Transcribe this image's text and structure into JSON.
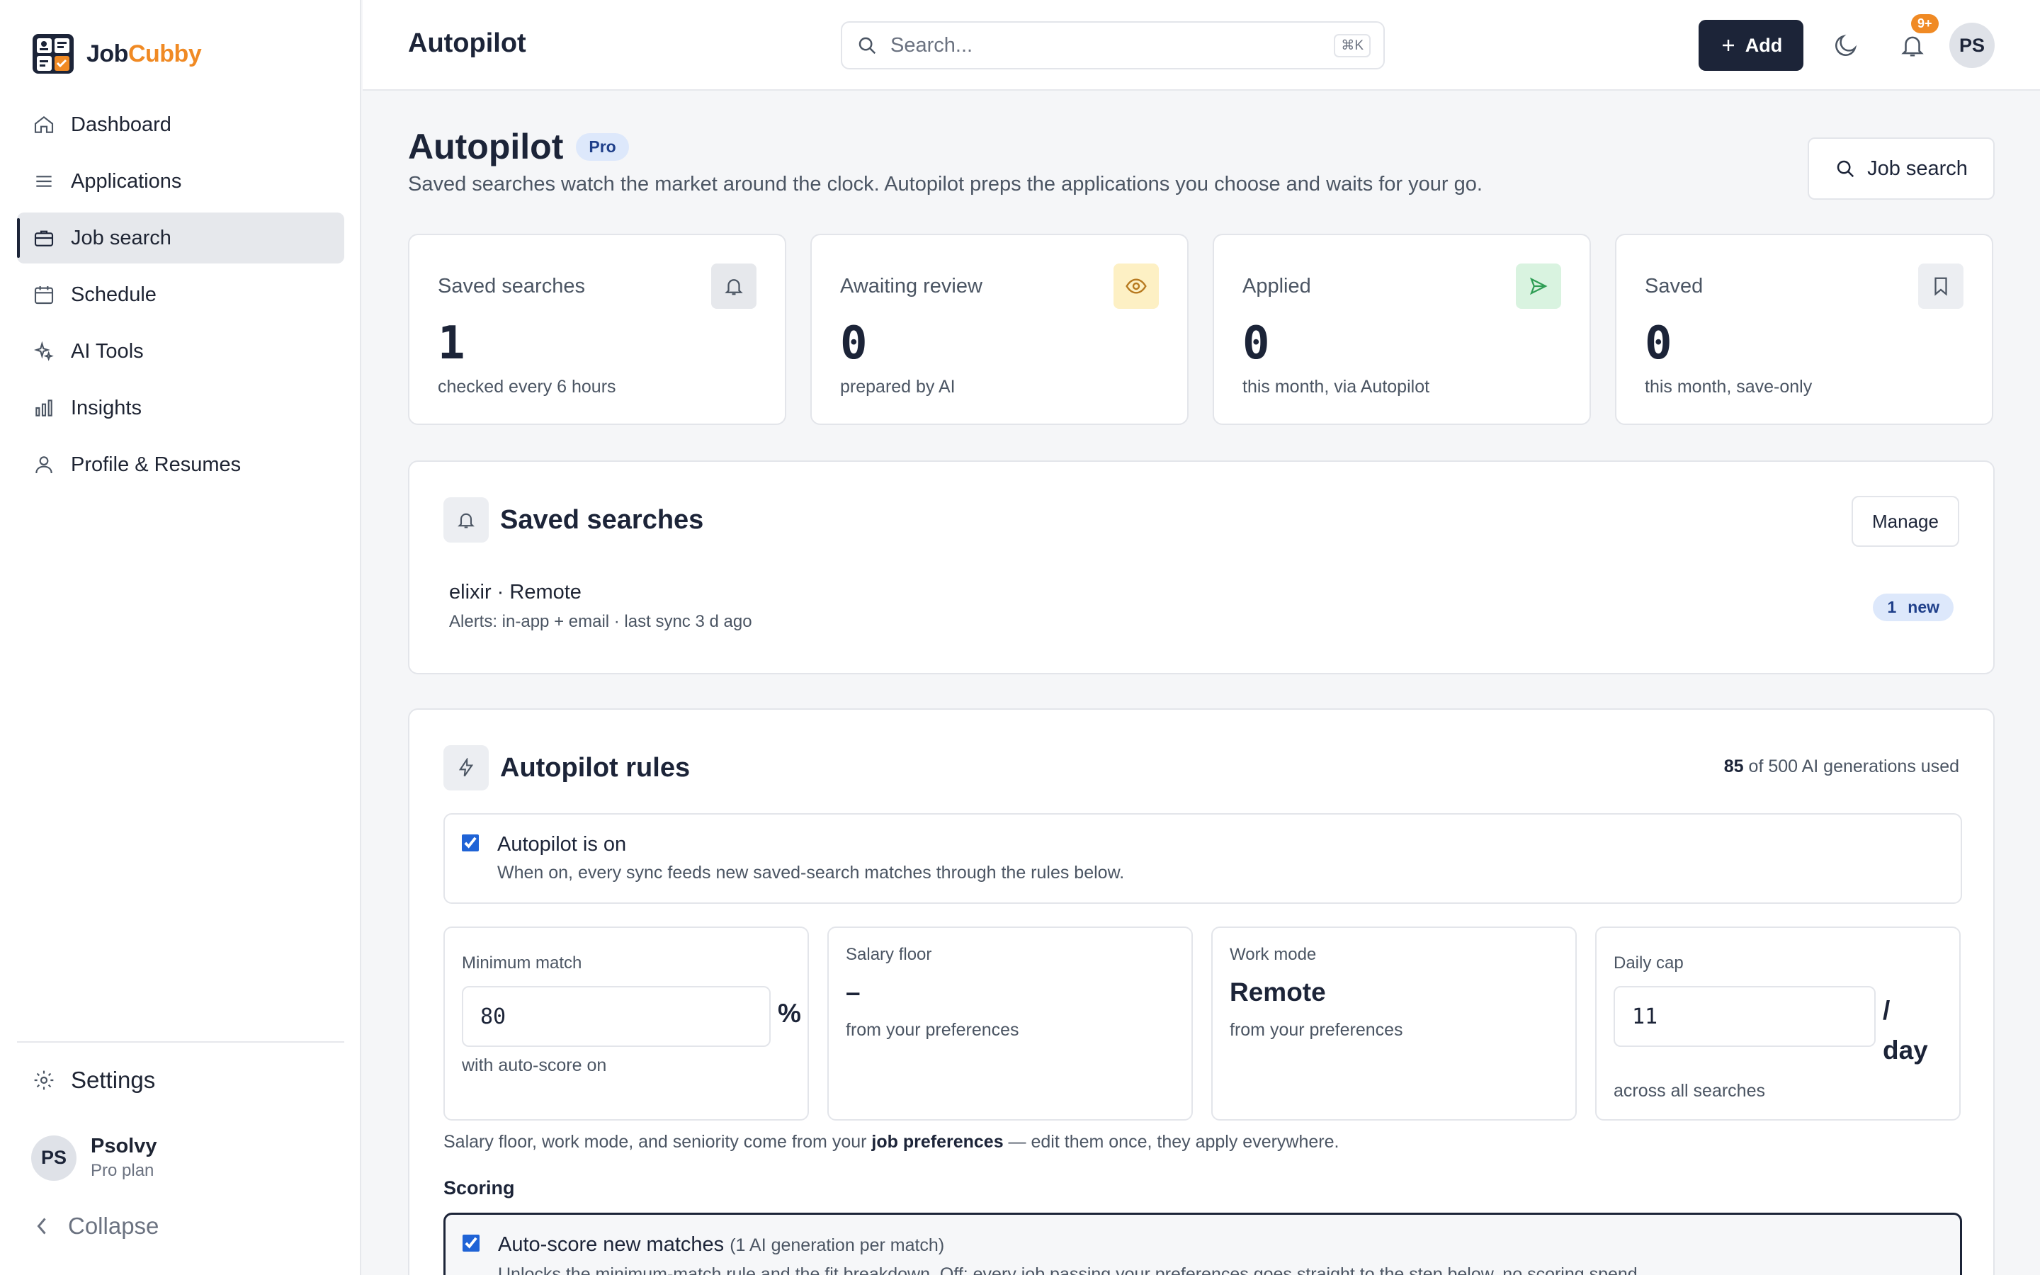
{
  "brand": {
    "name_part1": "Job",
    "name_part2": "Cubby",
    "accent_color": "#f08a24",
    "primary_color": "#1c2438"
  },
  "sidebar": {
    "items": [
      {
        "label": "Dashboard",
        "icon": "home-icon",
        "active": false
      },
      {
        "label": "Applications",
        "icon": "list-icon",
        "active": false
      },
      {
        "label": "Job search",
        "icon": "briefcase-icon",
        "active": true
      },
      {
        "label": "Schedule",
        "icon": "calendar-icon",
        "active": false
      },
      {
        "label": "AI Tools",
        "icon": "sparkles-icon",
        "active": false
      },
      {
        "label": "Insights",
        "icon": "bar-chart-icon",
        "active": false
      },
      {
        "label": "Profile & Resumes",
        "icon": "user-icon",
        "active": false
      }
    ],
    "settings_label": "Settings",
    "user": {
      "initials": "PS",
      "name": "Psolvy",
      "plan": "Pro plan"
    },
    "collapse_label": "Collapse"
  },
  "topbar": {
    "title": "Autopilot",
    "search_placeholder": "Search...",
    "search_shortcut": "⌘K",
    "add_label": "Add",
    "notification_badge": "9+",
    "avatar_initials": "PS"
  },
  "page": {
    "title": "Autopilot",
    "plan_pill": "Pro",
    "subtitle": "Saved searches watch the market around the clock. Autopilot preps the applications you choose and waits for your go.",
    "job_search_button": "Job search"
  },
  "stats": [
    {
      "label": "Saved searches",
      "value": "1",
      "sub": "checked every 6 hours",
      "icon": "bell-icon",
      "icon_bg": "#e6e8ec",
      "icon_color": "#4b5563"
    },
    {
      "label": "Awaiting review",
      "value": "0",
      "sub": "prepared by AI",
      "icon": "eye-icon",
      "icon_bg": "#fdf0c4",
      "icon_color": "#b7791f"
    },
    {
      "label": "Applied",
      "value": "0",
      "sub": "this month, via Autopilot",
      "icon": "send-icon",
      "icon_bg": "#d9f3e0",
      "icon_color": "#2f9e55"
    },
    {
      "label": "Saved",
      "value": "0",
      "sub": "this month, save-only",
      "icon": "bookmark-icon",
      "icon_bg": "#eceef2",
      "icon_color": "#4b5563"
    }
  ],
  "saved_searches": {
    "title": "Saved searches",
    "manage_label": "Manage",
    "items": [
      {
        "title": "elixir · Remote",
        "sub": "Alerts: in-app + email · last sync 3 d ago",
        "new_count": "1",
        "new_label": "new"
      }
    ]
  },
  "rules": {
    "title": "Autopilot rules",
    "usage_used": "85",
    "usage_rest": "of 500 AI generations used",
    "autopilot_toggle": {
      "title": "Autopilot is on",
      "sub": "When on, every sync feeds new saved-search matches through the rules below.",
      "checked": true
    },
    "min_match": {
      "label": "Minimum match",
      "value": "80",
      "unit": "%",
      "sub": "with auto-score on"
    },
    "salary_floor": {
      "label": "Salary floor",
      "value": "–",
      "sub": "from your preferences"
    },
    "work_mode": {
      "label": "Work mode",
      "value": "Remote",
      "sub": "from your preferences"
    },
    "daily_cap": {
      "label": "Daily cap",
      "value": "11",
      "unit_slash": "/",
      "unit_day": "day",
      "sub": "across all searches"
    },
    "prefs_note_before": "Salary floor, work mode, and seniority come from your ",
    "prefs_note_link": "job preferences",
    "prefs_note_after": " — edit them once, they apply everywhere.",
    "scoring_label": "Scoring",
    "auto_score": {
      "title": "Auto-score new matches",
      "hint": "(1 AI generation per match)",
      "sub": "Unlocks the minimum-match rule and the fit breakdown. Off: every job passing your preferences goes straight to the step below, no scoring spend.",
      "checked": true
    }
  }
}
